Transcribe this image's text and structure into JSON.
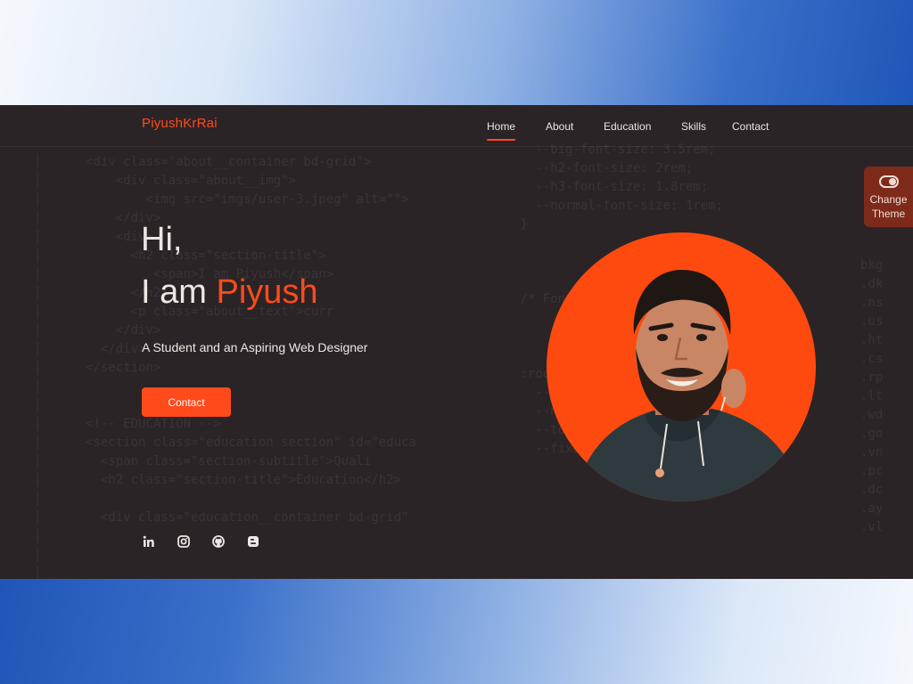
{
  "nav": {
    "logo": "PiyushKrRai",
    "links": [
      {
        "label": "Home",
        "active": true
      },
      {
        "label": "About",
        "active": false
      },
      {
        "label": "Education",
        "active": false
      },
      {
        "label": "Skills",
        "active": false
      },
      {
        "label": "Contact",
        "active": false
      }
    ]
  },
  "theme_toggle": {
    "line1": "Change",
    "line2": "Theme"
  },
  "hero": {
    "greeting": "Hi,",
    "intro": "I am ",
    "name": "Piyush",
    "subtitle": "A Student and an Aspiring Web Designer",
    "contact_label": "Contact"
  },
  "social": [
    "linkedin-icon",
    "instagram-icon",
    "github-icon",
    "blogger-icon"
  ],
  "colors": {
    "accent": "#ff4a1c",
    "background": "#2b2426",
    "theme_button": "#7e2a1a"
  }
}
